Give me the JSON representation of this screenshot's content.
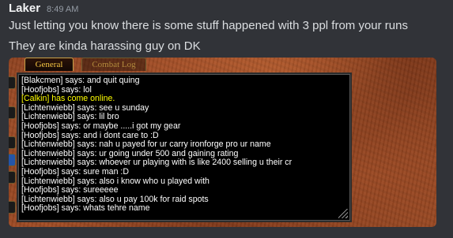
{
  "message": {
    "author": "Laker",
    "timestamp": "8:49 AM",
    "lines": [
      "Just letting you know there is some stuff happened with 3 ppl from your runs",
      "They are kinda harassing guy on DK"
    ]
  },
  "screenshot": {
    "tabs": [
      "General",
      "Combat Log"
    ],
    "chat_lines": [
      "[Blakcmen] says: and quit quing",
      "[Hoofjobs] says: lol",
      "[Calkin] has come online.",
      "[Lichtenwiebb] says: see u sunday",
      "[Lichtenwiebb] says: lil bro",
      "[Hoofjobs] says: or maybe .....i got my gear",
      "[Hoofjobs] says: and i dont care to :D",
      "[Lichtenwiebb] says: nah u payed for ur carry ironforge pro ur name",
      "[Lichtenwiebb] says: ur going under 500 and gaining rating",
      "[Lichtenwiebb] says: whoever ur playing with is like 2400 selling u their cr",
      "[Hoofjobs] says: sure man :D",
      "[Lichtenwiebb] says: also i know who u played with",
      "[Hoofjobs] says: sureeeee",
      "[Lichtenwiebb] says: also u pay 100k for raid spots",
      "[Hoofjobs] says: whats tehre name"
    ],
    "system_line_color": "#ffff00",
    "text_color": "#ffffff"
  }
}
